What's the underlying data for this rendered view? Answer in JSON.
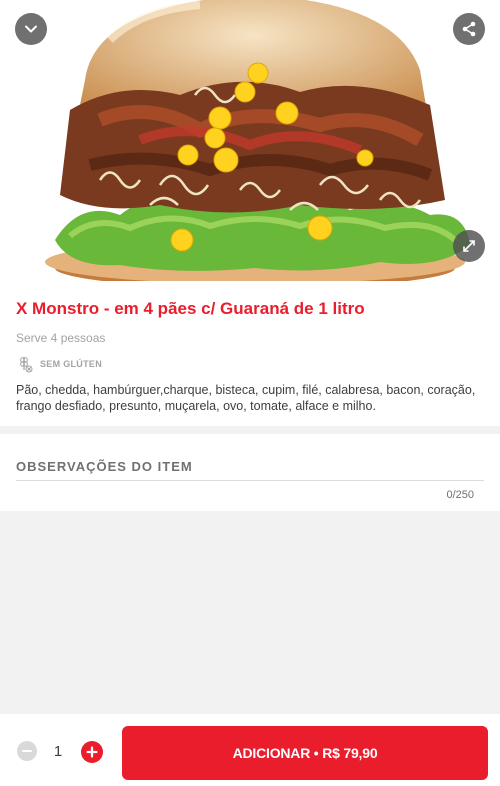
{
  "product": {
    "image_alt": "X Monstro burger photo",
    "title": "X Monstro - em 4 pães c/ Guaraná de 1 litro",
    "serves": "Serve 4 pessoas",
    "tag": "SEM GLÚTEN",
    "description": "Pão, chedda, hambúrguer,charque, bisteca, cupim, filé, calabresa, bacon, coração, frango desfiado, presunto, muçarela, ovo, tomate, alface e milho."
  },
  "header_icons": {
    "back": "chevron-down-icon",
    "share": "share-icon",
    "expand": "expand-icon"
  },
  "observations": {
    "title": "OBSERVAÇÕES DO ITEM",
    "value": "",
    "counter": "0/250"
  },
  "footer": {
    "quantity": "1",
    "add_button_label": "ADICIONAR • R$ 79,90"
  },
  "colors": {
    "brand_red": "#ea1d2c",
    "muted_text": "#a6a29f",
    "body_text": "#3e3e3e"
  }
}
